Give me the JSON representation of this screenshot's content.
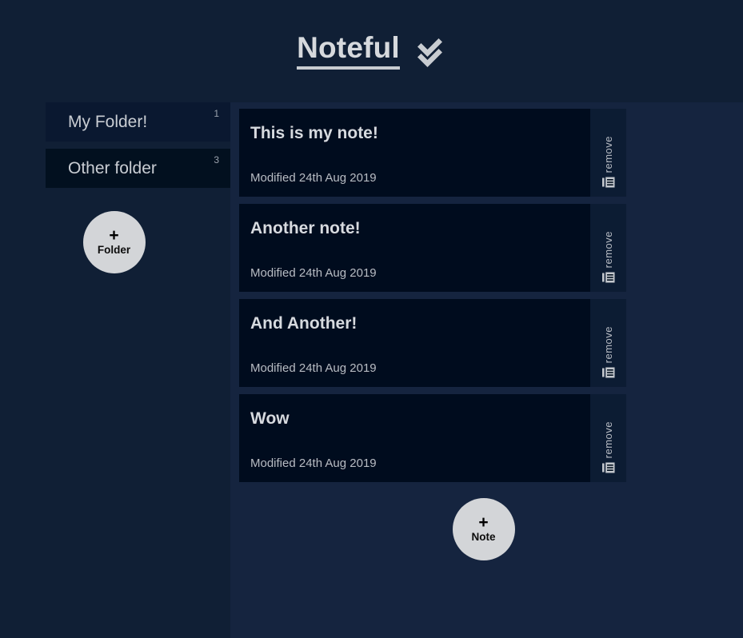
{
  "app": {
    "brand_name": "Noteful",
    "brand_icon": "double-check-icon",
    "background_color": "#101f35",
    "panel_color": "#15243f",
    "card_color": "#000c1e",
    "accent_text_color": "#d7dadf",
    "button_color": "#d3d5d8"
  },
  "sidebar": {
    "folders": [
      {
        "name": "My Folder!",
        "count": "1",
        "selected": true
      },
      {
        "name": "Other folder",
        "count": "3",
        "selected": false
      }
    ],
    "add_folder": {
      "plus": "+",
      "label": "Folder",
      "icon": "plus-icon"
    }
  },
  "notes_panel": {
    "notes": [
      {
        "title": "This is my note!",
        "modified": "Modified 24th Aug 2019",
        "remove_label": "remove",
        "remove_icon": "note-list-icon"
      },
      {
        "title": "Another note!",
        "modified": "Modified 24th Aug 2019",
        "remove_label": "remove",
        "remove_icon": "note-list-icon"
      },
      {
        "title": "And Another!",
        "modified": "Modified 24th Aug 2019",
        "remove_label": "remove",
        "remove_icon": "note-list-icon"
      },
      {
        "title": "Wow",
        "modified": "Modified 24th Aug 2019",
        "remove_label": "remove",
        "remove_icon": "note-list-icon"
      }
    ],
    "add_note": {
      "plus": "+",
      "label": "Note",
      "icon": "plus-icon"
    }
  }
}
